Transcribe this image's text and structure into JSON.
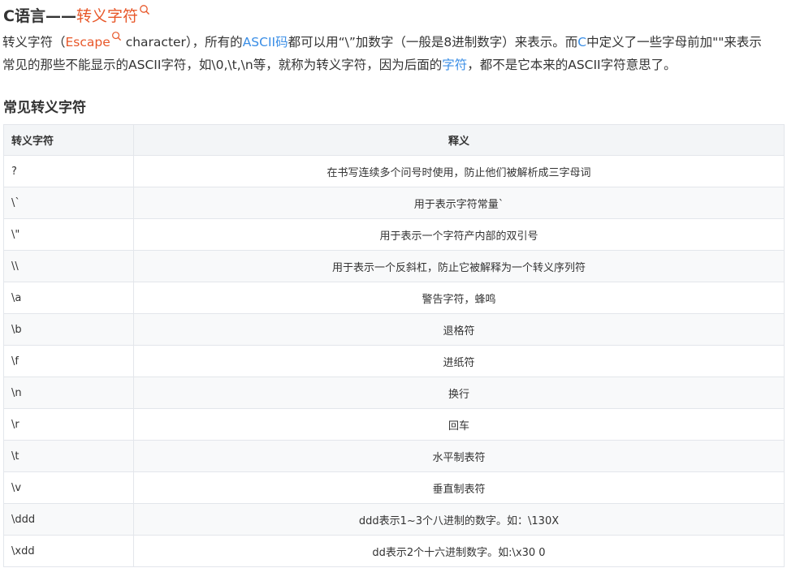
{
  "title": {
    "prefix": "C语言——",
    "keyword": "转义字符"
  },
  "intro": {
    "line1": {
      "p1": " 转义字符（",
      "escape_word": "Escape",
      "p2": " character），所有的",
      "ascii_code_link": "ASCII码",
      "p3": "都可以用“\\”加数字（一般是8进制数字）来表示。而",
      "c_link": "C",
      "p4": "中定义了一些字母前加\"\"来表示"
    },
    "line2": {
      "p1": "常见的那些不能显示的ASCII字符，如\\0,\\t,\\n等，就称为转义字符，因为后面的",
      "char_link": "字符",
      "p2": "，都不是它本来的ASCII字符意思了。"
    }
  },
  "section_title": "常见转义字符",
  "table": {
    "headers": [
      "转义字符",
      "释义"
    ],
    "rows": [
      [
        "?",
        "在书写连续多个问号时使用，防止他们被解析成三字母词"
      ],
      [
        "\\`",
        "用于表示字符常量`"
      ],
      [
        "\\\"",
        "用于表示一个字符产内部的双引号"
      ],
      [
        "\\\\",
        "用于表示一个反斜杠，防止它被解释为一个转义序列符"
      ],
      [
        "\\a",
        "警告字符，蜂鸣"
      ],
      [
        "\\b",
        "退格符"
      ],
      [
        "\\f",
        "进纸符"
      ],
      [
        "\\n",
        "换行"
      ],
      [
        "\\r",
        "回车"
      ],
      [
        "\\t",
        "水平制表符"
      ],
      [
        "\\v",
        "垂直制表符"
      ],
      [
        "\\ddd",
        "ddd表示1~3个八进制的数字。如：\\130X"
      ],
      [
        "\\xdd",
        "dd表示2个十六进制数字。如:\\x30 0"
      ]
    ]
  },
  "colors": {
    "keyword": "#e8582a",
    "link": "#3a8ee6",
    "text": "#333333",
    "header_bg": "#f3f5f7",
    "border": "#e3e6eb"
  }
}
